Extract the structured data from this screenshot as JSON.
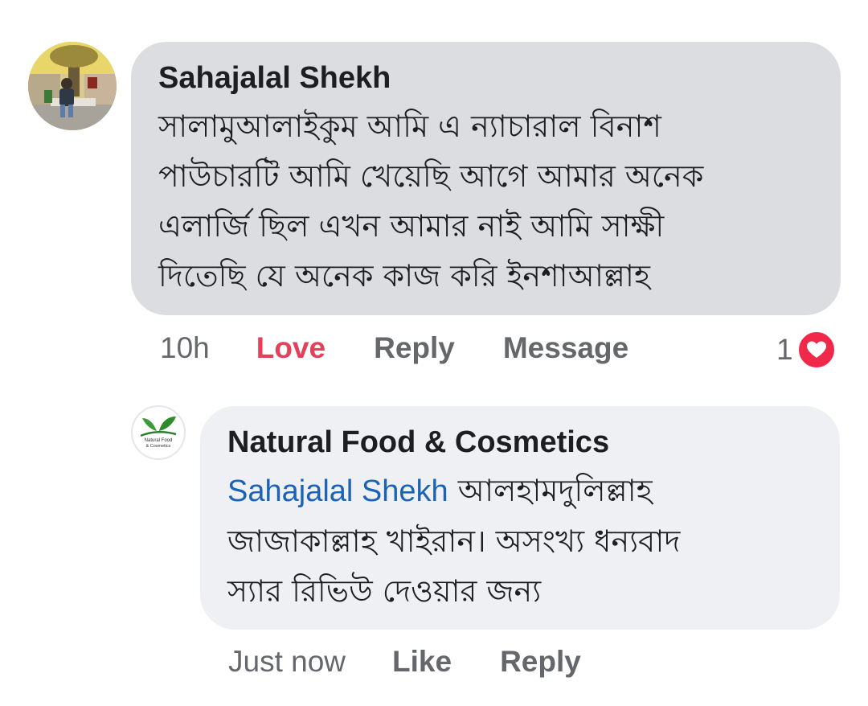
{
  "comment": {
    "author": "Sahajalal Shekh",
    "lines": [
      "সালামুআলাইকুম আমি এ ন্যাচারাল বিনাশ",
      "পাউচারটি আমি খেয়েছি আগে আমার অনেক",
      "এলার্জি ছিল এখন আমার নাই আমি সাক্ষী",
      "দিতেছি যে অনেক কাজ করি ইনশাআল্লাহ"
    ],
    "time": "10h",
    "love_label": "Love",
    "reply_label": "Reply",
    "message_label": "Message",
    "reaction_count": "1",
    "reaction_icon": "heart-icon"
  },
  "reply": {
    "author": "Natural Food & Cosmetics",
    "mention": "Sahajalal Shekh",
    "first_line_rest": " আলহামদুলিল্লাহ",
    "lines": [
      "জাজাকাল্লাহ খাইরান। অসংখ্য ধন্যবাদ",
      "স্যার রিভিউ দেওয়ার জন্য"
    ],
    "logo_text_1": "Natural Food",
    "logo_text_2": "& Cosmetics",
    "time": "Just now",
    "like_label": "Like",
    "reply_label": "Reply"
  },
  "colors": {
    "bubble_main": "#dcdde1",
    "bubble_reply": "#eff0f3",
    "love": "#e4405a",
    "mention": "#1b63b5",
    "heart": "#f0284a"
  }
}
